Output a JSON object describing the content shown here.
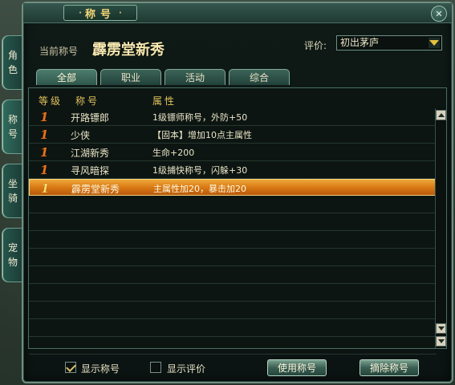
{
  "window": {
    "title": "称号",
    "close_label": "✕"
  },
  "side_tabs": [
    {
      "label": "角色"
    },
    {
      "label": "称号"
    },
    {
      "label": "坐骑"
    },
    {
      "label": "宠物"
    }
  ],
  "header": {
    "current_label": "当前称号",
    "current_title": "霹雳堂新秀",
    "rating_label": "评价:",
    "rating_value": "初出茅庐"
  },
  "tabs": [
    {
      "label": "全部"
    },
    {
      "label": "职业"
    },
    {
      "label": "活动"
    },
    {
      "label": "综合"
    }
  ],
  "table": {
    "headers": {
      "level": "等级",
      "name": "称号",
      "attr": "属性"
    },
    "rows": [
      {
        "level": "1",
        "name": "开路镖郎",
        "attr": "1级镖师称号，外防+50"
      },
      {
        "level": "1",
        "name": "少侠",
        "attr": "【固本】增加10点主属性"
      },
      {
        "level": "1",
        "name": "江湖新秀",
        "attr": "生命+200"
      },
      {
        "level": "1",
        "name": "寻风暗探",
        "attr": "1级捕快称号，闪躲+30"
      },
      {
        "level": "1",
        "name": "霹雳堂新秀",
        "attr": "主属性加20，暴击加20"
      }
    ]
  },
  "bottom": {
    "show_title_label": "显示称号",
    "show_rating_label": "显示评价",
    "use_button": "使用称号",
    "remove_button": "摘除称号"
  },
  "colors": {
    "accent_gold": "#e3c35e",
    "selected_row": "#d87a14",
    "frame": "#6f8f82"
  }
}
